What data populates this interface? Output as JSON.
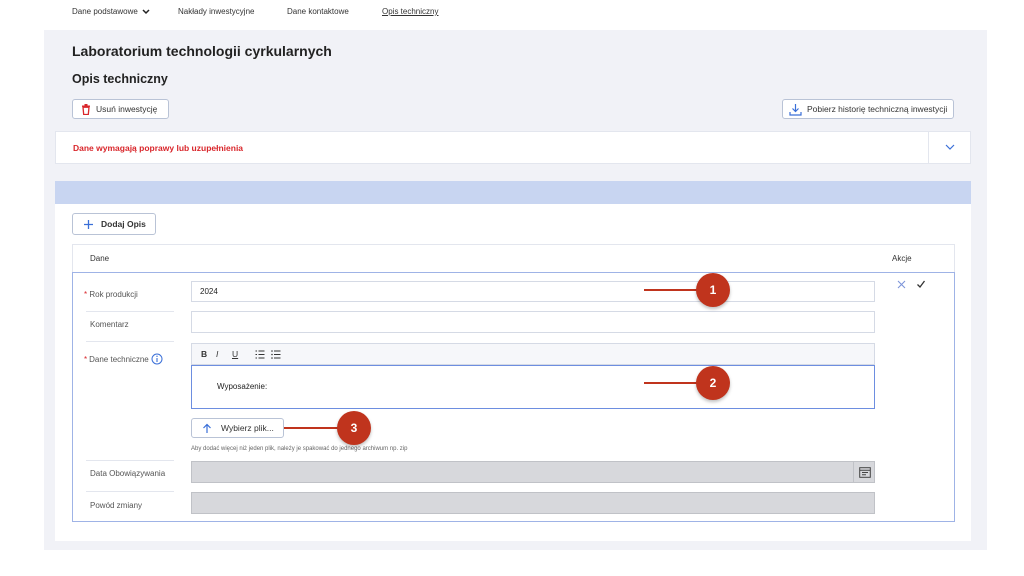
{
  "app": {
    "title": "Laboratorium technologii cyrkularnych",
    "section_title": "Opis techniczny"
  },
  "toolbar": {
    "delete_label": "Usuń inwestycję",
    "history_label": "Pobierz historię techniczną inwestycji"
  },
  "alert": {
    "message": "Dane wymagają poprawy lub uzupełnienia"
  },
  "tabs": [
    {
      "label": "Dane podstawowe",
      "has_dropdown": true
    },
    {
      "label": "Nakłady inwestycyjne"
    },
    {
      "label": "Dane kontaktowe"
    },
    {
      "label": "Opis techniczny",
      "active": true
    }
  ],
  "add_button": {
    "label": "Dodaj Opis"
  },
  "table": {
    "col_data": "Dane",
    "col_actions": "Akcje"
  },
  "form": {
    "required_mark": "*",
    "year_label": "Rok produkcji",
    "year_value": "2024",
    "comment_label": "Komentarz",
    "comment_value": "",
    "tech_label": "Dane techniczne",
    "editor_buttons": [
      "B",
      "I",
      "U"
    ],
    "editor_content": "Wyposażenie:",
    "file_button": "Wybierz plik...",
    "file_hint": "Aby dodać więcej niż jeden plik, należy je spakować do jednego archiwum np. zip",
    "valid_date_label": "Data Obowiązywania",
    "valid_date_value": "",
    "reason_label": "Powód zmiany",
    "reason_value": ""
  },
  "callouts": [
    "1",
    "2",
    "3"
  ],
  "colors": {
    "accent": "#c0341d",
    "error_text": "#d9262b",
    "tab_bar": "#c8d5f1",
    "link_blue": "#3a6fd8"
  }
}
